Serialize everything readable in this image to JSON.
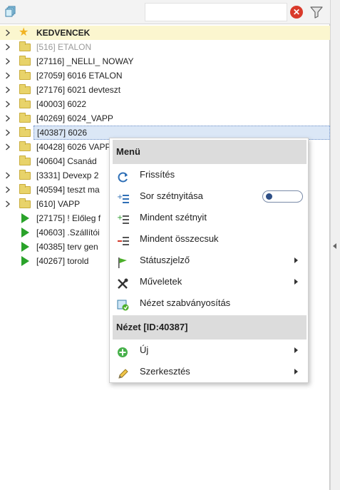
{
  "toolbar": {
    "left_icon": "copy-icon",
    "search_placeholder": "",
    "clear_icon": "clear-icon",
    "clear_glyph": "✕",
    "filter_icon": "filter-icon"
  },
  "tree": {
    "items": [
      {
        "label": "KEDVENCEK",
        "icon": "star-icon",
        "expandable": true,
        "style": "favorite"
      },
      {
        "label": "[516] ETALON",
        "icon": "folder-icon",
        "expandable": true,
        "style": "muted"
      },
      {
        "label": "[27116] _NELLI_ NOWAY",
        "icon": "folder-icon",
        "expandable": true
      },
      {
        "label": "[27059] 6016 ETALON",
        "icon": "folder-icon",
        "expandable": true
      },
      {
        "label": "[27176] 6021 devteszt",
        "icon": "folder-icon",
        "expandable": true
      },
      {
        "label": "[40003] 6022",
        "icon": "folder-icon",
        "expandable": true
      },
      {
        "label": "[40269] 6024_VAPP",
        "icon": "folder-icon",
        "expandable": true
      },
      {
        "label": "[40387] 6026",
        "icon": "folder-icon",
        "expandable": true,
        "selected": true
      },
      {
        "label": "[40428] 6026 VAPP",
        "icon": "folder-icon",
        "expandable": true
      },
      {
        "label": "[40604] Csanád",
        "icon": "folder-icon",
        "expandable": false
      },
      {
        "label": "[3331] Devexp 2",
        "icon": "folder-icon",
        "expandable": true
      },
      {
        "label": "[40594] teszt ma",
        "icon": "folder-icon",
        "expandable": true
      },
      {
        "label": "[610] VAPP",
        "icon": "folder-icon",
        "expandable": true
      },
      {
        "label": "[27175] ! Előleg f",
        "icon": "play-icon",
        "expandable": false
      },
      {
        "label": "[40603] .Szállítói",
        "icon": "play-icon",
        "expandable": false
      },
      {
        "label": "[40385] terv gen",
        "icon": "play-icon",
        "expandable": false
      },
      {
        "label": "[40267] torold",
        "icon": "play-icon",
        "expandable": false
      }
    ]
  },
  "context_menu": {
    "header1": "Menü",
    "header2": "Nézet [ID:40387]",
    "items": [
      {
        "label": "Frissítés",
        "icon": "refresh-icon"
      },
      {
        "label": "Sor szétnyitása",
        "icon": "expand-row-icon",
        "toggle": true,
        "toggle_on": false
      },
      {
        "label": "Mindent szétnyit",
        "icon": "expand-all-icon"
      },
      {
        "label": "Mindent összecsuk",
        "icon": "collapse-all-icon"
      },
      {
        "label": "Státuszjelző",
        "icon": "flag-icon",
        "submenu": true
      },
      {
        "label": "Műveletek",
        "icon": "tools-icon",
        "submenu": true
      },
      {
        "label": "Nézet szabványosítás",
        "icon": "standardize-icon"
      },
      {
        "label": "Új",
        "icon": "add-icon",
        "submenu": true
      },
      {
        "label": "Szerkesztés",
        "icon": "edit-icon",
        "submenu": true
      }
    ]
  },
  "colors": {
    "favorite_row": "#fbf6cf",
    "selection": "#dbe7f6",
    "folder": "#e8d36a",
    "play": "#2aa32a",
    "clear": "#d93a2b"
  }
}
